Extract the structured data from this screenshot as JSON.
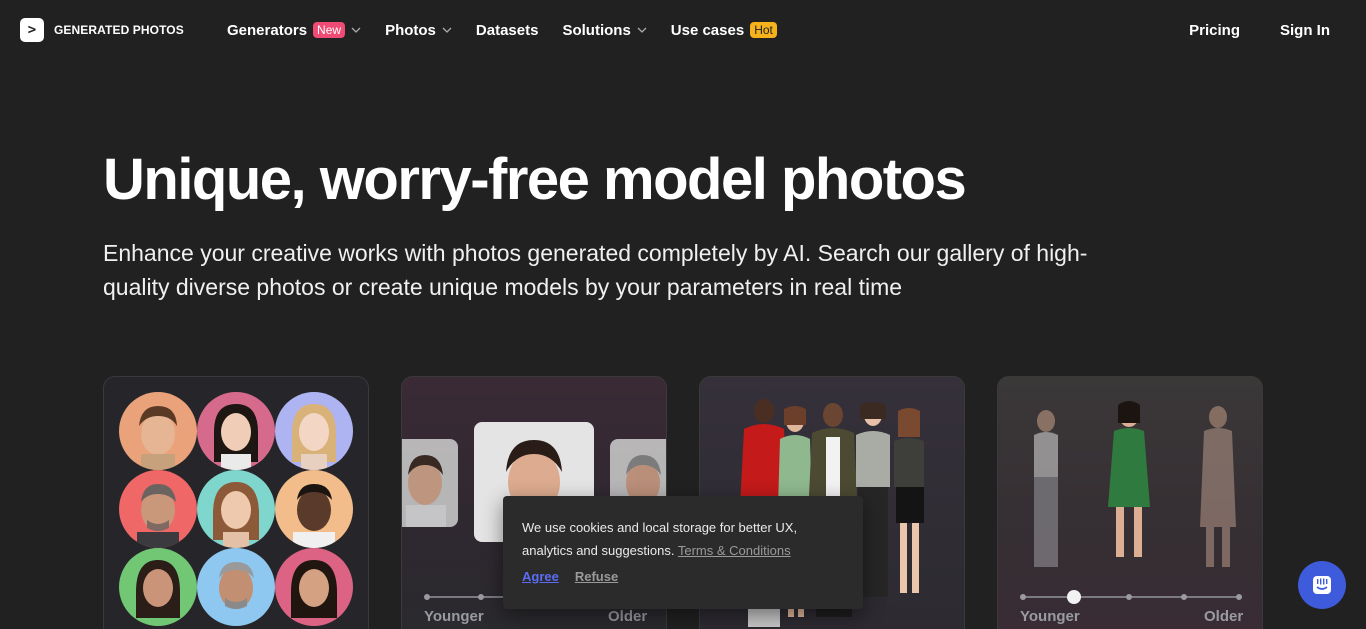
{
  "nav": {
    "logo_text": "GENERATED PHOTOS",
    "items": [
      {
        "label": "Generators",
        "badge": "New",
        "dropdown": true
      },
      {
        "label": "Photos",
        "badge": "",
        "dropdown": true
      },
      {
        "label": "Datasets",
        "badge": "",
        "dropdown": false
      },
      {
        "label": "Solutions",
        "badge": "",
        "dropdown": true
      },
      {
        "label": "Use cases",
        "badge": "Hot",
        "dropdown": false
      }
    ],
    "pricing": "Pricing",
    "sign_in": "Sign In"
  },
  "hero": {
    "title": "Unique, worry-free model photos",
    "subtitle": "Enhance your creative works with photos generated completely by AI. Search our gallery of high-quality diverse photos or create unique models by your parameters in real time"
  },
  "cards": {
    "age_card": {
      "younger": "Younger",
      "older": "Older"
    },
    "body_card": {
      "younger": "Younger",
      "older": "Older"
    }
  },
  "cookie": {
    "text": "We use cookies and local storage for better UX, analytics and suggestions.",
    "link": "Terms & Conditions",
    "agree": "Agree",
    "refuse": "Refuse"
  },
  "colors": {
    "background": "#212121",
    "badge_new": "#ef4b74",
    "badge_hot": "#f6b21a",
    "agree": "#5b6cf5",
    "chat": "#3d5bdb"
  },
  "icons": {
    "logo": "terminal-prompt-icon",
    "dropdown": "chevron-down-icon",
    "chat": "chat-icon"
  }
}
